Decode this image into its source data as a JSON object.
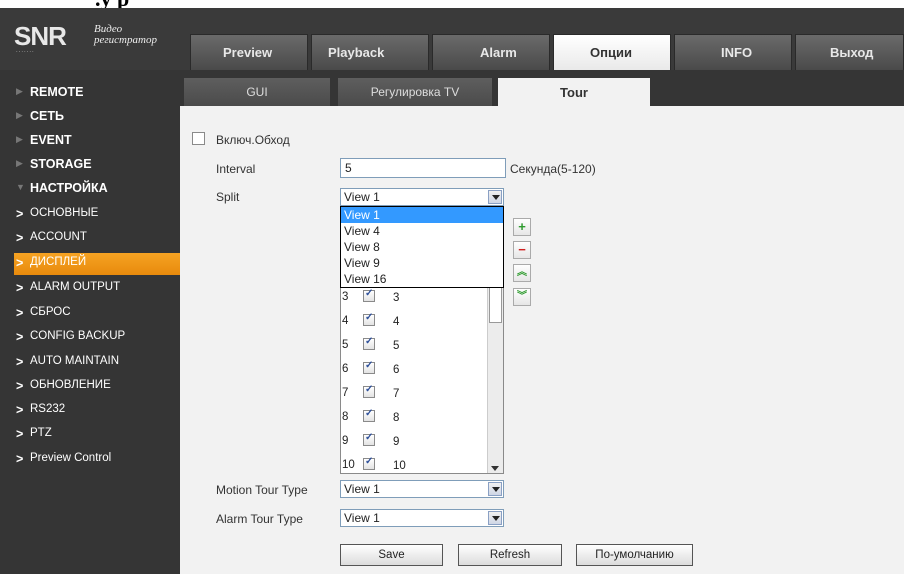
{
  "header": {
    "logo": {
      "brand": "SNR",
      "tagline_line1": "Видео",
      "tagline_line2": "регистратор"
    },
    "tabs": [
      {
        "label": "Preview"
      },
      {
        "label": "Playback"
      },
      {
        "label": "Alarm"
      },
      {
        "label": "Опции"
      },
      {
        "label": "INFO"
      },
      {
        "label": "Выход"
      }
    ],
    "active_tab": "Опции"
  },
  "sidebar": {
    "sections": [
      {
        "label": "REMOTE"
      },
      {
        "label": "СЕТЬ"
      },
      {
        "label": "EVENT"
      },
      {
        "label": "STORAGE"
      },
      {
        "label": "НАСТРОЙКА"
      }
    ],
    "items": [
      {
        "label": "ОСНОВНЫЕ"
      },
      {
        "label": "ACCOUNT"
      },
      {
        "label": "ДИСПЛЕЙ"
      },
      {
        "label": "ALARM OUTPUT"
      },
      {
        "label": "СБРОС"
      },
      {
        "label": "CONFIG BACKUP"
      },
      {
        "label": "AUTO MAINTAIN"
      },
      {
        "label": "ОБНОВЛЕНИЕ"
      },
      {
        "label": "RS232"
      },
      {
        "label": "PTZ"
      },
      {
        "label": "Preview Control"
      }
    ],
    "active_item": "ДИСПЛЕЙ"
  },
  "subtabs": [
    {
      "label": "GUI"
    },
    {
      "label": "Регулировка TV"
    },
    {
      "label": "Tour"
    }
  ],
  "active_subtab": "Tour",
  "form": {
    "enable_tour_label": "Включ.Обход",
    "enable_tour_checked": false,
    "interval_label": "Interval",
    "interval_value": "5",
    "interval_unit": "Секунда(5-120)",
    "split_label": "Split",
    "split_value": "View 1",
    "split_options": [
      "View 1",
      "View 4",
      "View 8",
      "View 9",
      "View 16"
    ],
    "split_selected": "View 1",
    "channel_rows": [
      {
        "num": "3",
        "name": "3",
        "checked": true
      },
      {
        "num": "4",
        "name": "4",
        "checked": true
      },
      {
        "num": "5",
        "name": "5",
        "checked": true
      },
      {
        "num": "6",
        "name": "6",
        "checked": true
      },
      {
        "num": "7",
        "name": "7",
        "checked": true
      },
      {
        "num": "8",
        "name": "8",
        "checked": true
      },
      {
        "num": "9",
        "name": "9",
        "checked": true
      },
      {
        "num": "10",
        "name": "10",
        "checked": true
      }
    ],
    "motion_tour_label": "Motion Tour Type",
    "motion_tour_value": "View 1",
    "alarm_tour_label": "Alarm Tour Type",
    "alarm_tour_value": "View 1"
  },
  "buttons": {
    "save": "Save",
    "refresh": "Refresh",
    "default": "По-умолчанию",
    "add_icon": "+",
    "remove_icon": "−",
    "up_icon": "≈",
    "down_icon": "≈"
  },
  "colors": {
    "active_orange": "#f39a1c",
    "header_dark": "#3a3a3a",
    "selection_blue": "#3399ff"
  }
}
